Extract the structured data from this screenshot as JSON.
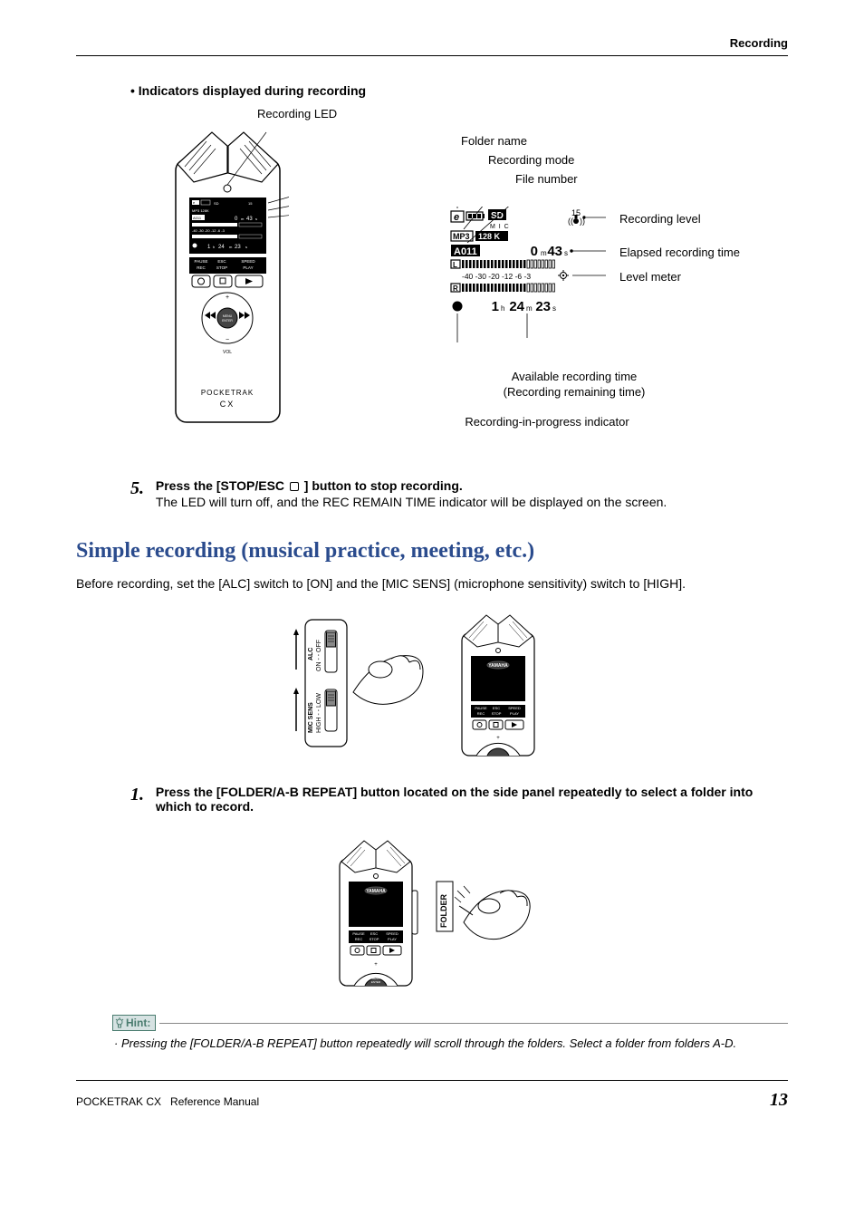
{
  "header": {
    "section": "Recording"
  },
  "indicators": {
    "heading": "• Indicators displayed during recording",
    "led_label": "Recording LED",
    "callouts": {
      "folder_name": "Folder name",
      "recording_mode": "Recording mode",
      "file_number": "File number",
      "recording_level": "Recording level",
      "elapsed": "Elapsed recording time",
      "level_meter": "Level meter",
      "available_l1": "Available recording time",
      "available_l2": "(Recording remaining time)",
      "rip": "Recording-in-progress indicator"
    },
    "lcd": {
      "folder": "e",
      "sd": "SD",
      "mic": "M I C",
      "mp3": "MP3",
      "bitrate": "128 K",
      "file": "A011",
      "elapsed_m": "0",
      "elapsed_s": "43",
      "level_num": "15",
      "meter_scale": "-40 -30 -20 -12 -6 -3",
      "remain_h": "1",
      "remain_m": "24",
      "remain_s": "23",
      "unit_h": "h",
      "unit_m": "m",
      "unit_s": "s"
    },
    "device_buttons": {
      "pause": "PAUSE",
      "esc": "ESC",
      "speed": "SPEED",
      "rec": "REC",
      "stop": "STOP",
      "play": "PLAY",
      "menu": "MENU\nENTER",
      "vol": "VOL"
    },
    "device_brand": "POCKETRAK",
    "device_model": "CX"
  },
  "step5": {
    "num": "5.",
    "title_pre": "Press the [STOP/ESC ",
    "title_post": " ] button to stop recording.",
    "body": "The LED will turn off, and the REC REMAIN TIME indicator will be displayed on the screen."
  },
  "section": {
    "heading": "Simple recording (musical practice, meeting, etc.)",
    "intro": "Before recording, set the [ALC] switch to [ON] and the [MIC SENS] (microphone sensitivity) switch to [HIGH]."
  },
  "switches": {
    "alc": "ALC",
    "onoff": "ON - - OFF",
    "micsens": "MIC SENS",
    "highlow": "HIGH - - LOW",
    "yamaha": "YAMAHA",
    "folder": "FOLDER"
  },
  "step1": {
    "num": "1.",
    "title": "Press the [FOLDER/A-B REPEAT] button located on the side panel repeatedly to select a folder into which to record."
  },
  "hint": {
    "label": "Hint:",
    "text": "· Pressing the [FOLDER/A-B REPEAT] button repeatedly will scroll through the folders. Select a folder from folders A-D."
  },
  "footer": {
    "product": "POCKETRAK CX",
    "doc": "Reference Manual",
    "page": "13"
  }
}
